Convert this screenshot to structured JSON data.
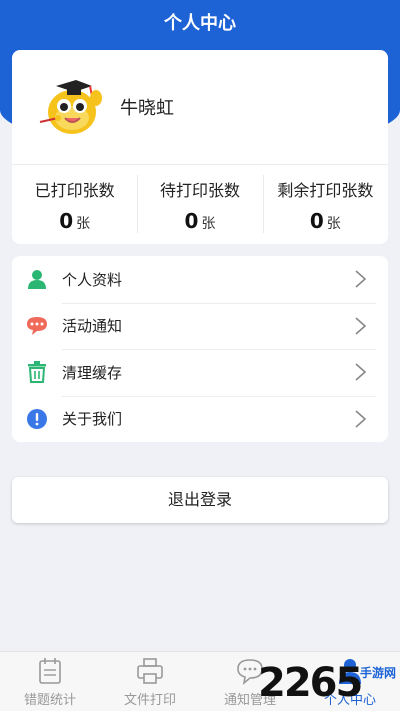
{
  "header": {
    "title": "个人中心"
  },
  "profile": {
    "username": "牛晓虹"
  },
  "stats": [
    {
      "label": "已打印张数",
      "value": "0",
      "unit": "张"
    },
    {
      "label": "待打印张数",
      "value": "0",
      "unit": "张"
    },
    {
      "label": "剩余打印张数",
      "value": "0",
      "unit": "张"
    }
  ],
  "menu": [
    {
      "label": "个人资料",
      "icon": "person-icon"
    },
    {
      "label": "活动通知",
      "icon": "chat-bubble-icon"
    },
    {
      "label": "清理缓存",
      "icon": "trash-icon"
    },
    {
      "label": "关于我们",
      "icon": "info-icon"
    }
  ],
  "logout_label": "退出登录",
  "tabs": [
    {
      "label": "错题统计",
      "icon": "calendar-icon",
      "active": false
    },
    {
      "label": "文件打印",
      "icon": "printer-icon",
      "active": false
    },
    {
      "label": "通知管理",
      "icon": "chat-icon",
      "active": false
    },
    {
      "label": "个人中心",
      "icon": "user-icon",
      "active": true
    }
  ],
  "watermark": {
    "number": "2265",
    "text": "手游网"
  },
  "colors": {
    "primary": "#1e63d6",
    "menu_person": "#2bb673",
    "menu_chat": "#f06a5a",
    "menu_trash": "#2bb673",
    "menu_info": "#3b78e7"
  }
}
